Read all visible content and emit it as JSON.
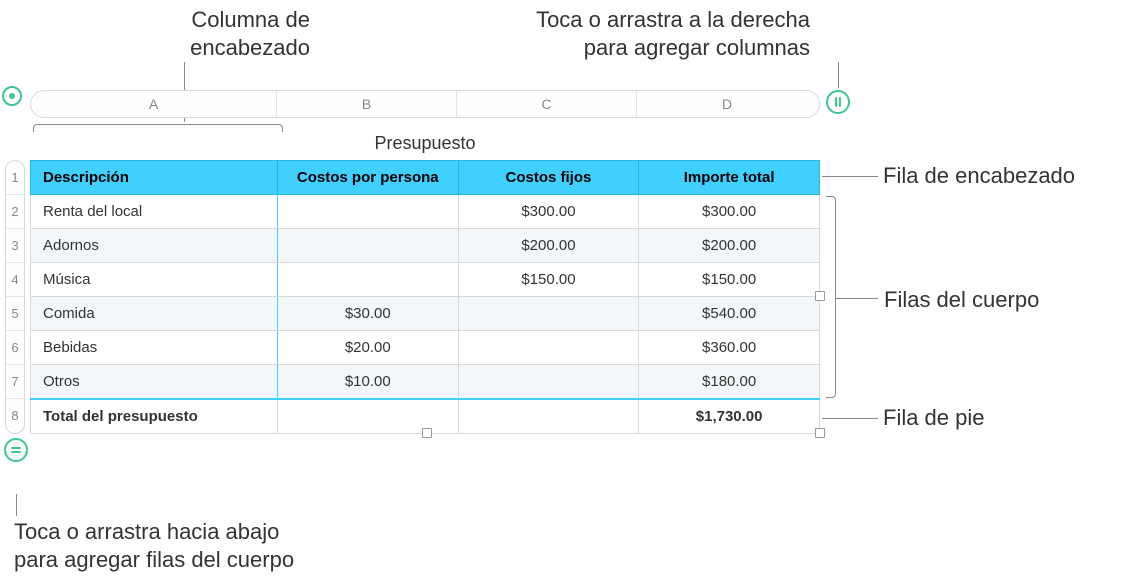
{
  "callouts": {
    "header_col": "Columna de\nencabezado",
    "add_cols": "Toca o arrastra a la derecha\npara agregar columnas",
    "header_row": "Fila de encabezado",
    "body_rows": "Filas del cuerpo",
    "footer_row": "Fila de pie",
    "add_rows": "Toca o arrastra hacia abajo\npara agregar filas del cuerpo"
  },
  "col_letters": {
    "a": "A",
    "b": "B",
    "c": "C",
    "d": "D"
  },
  "row_numbers": [
    "1",
    "2",
    "3",
    "4",
    "5",
    "6",
    "7",
    "8"
  ],
  "table": {
    "title": "Presupuesto",
    "headers": {
      "desc": "Descripción",
      "per_person": "Costos por persona",
      "fixed": "Costos fijos",
      "total": "Importe total"
    },
    "rows": [
      {
        "desc": "Renta del local",
        "per_person": "",
        "fixed": "$300.00",
        "total": "$300.00"
      },
      {
        "desc": "Adornos",
        "per_person": "",
        "fixed": "$200.00",
        "total": "$200.00"
      },
      {
        "desc": "Música",
        "per_person": "",
        "fixed": "$150.00",
        "total": "$150.00"
      },
      {
        "desc": "Comida",
        "per_person": "$30.00",
        "fixed": "",
        "total": "$540.00"
      },
      {
        "desc": "Bebidas",
        "per_person": "$20.00",
        "fixed": "",
        "total": "$360.00"
      },
      {
        "desc": "Otros",
        "per_person": "$10.00",
        "fixed": "",
        "total": "$180.00"
      }
    ],
    "footer": {
      "desc": "Total del presupuesto",
      "per_person": "",
      "fixed": "",
      "total": "$1,730.00"
    }
  }
}
